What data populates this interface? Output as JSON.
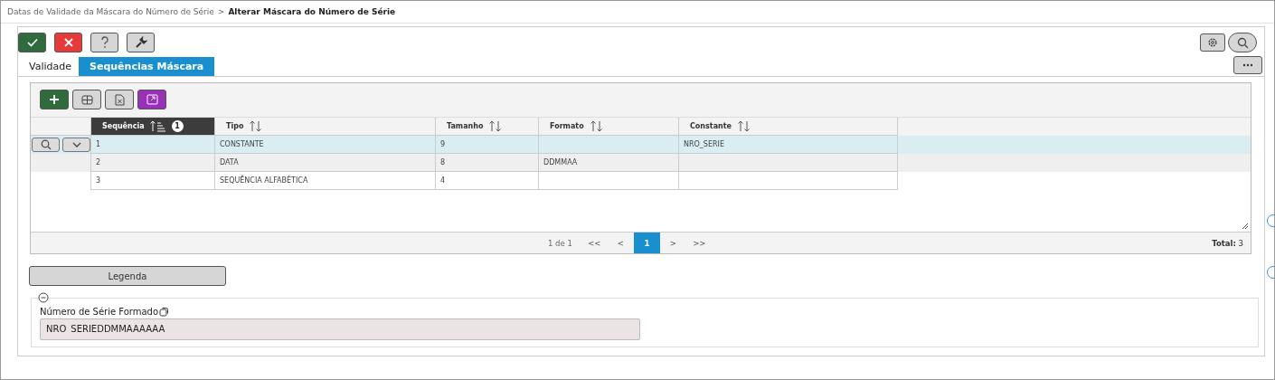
{
  "breadcrumb": {
    "parent": "Datas de Validade da Máscara do Número de Série",
    "separator": ">",
    "current": "Alterar Máscara do Número de Série"
  },
  "toolbar": [
    {
      "kind": "confirm"
    },
    {
      "kind": "cancel"
    },
    {
      "kind": "help"
    },
    {
      "kind": "tools"
    }
  ],
  "tabs": [
    {
      "label": "Validade",
      "selected": false
    },
    {
      "label": "Sequências Máscara",
      "selected": true
    }
  ],
  "grid": {
    "toolbar": [
      {
        "kind": "add"
      },
      {
        "kind": "columns"
      },
      {
        "kind": "export"
      },
      {
        "kind": "expand"
      }
    ],
    "columns": [
      {
        "label": "Sequência",
        "sorted": true,
        "sort_rank": "1"
      },
      {
        "label": "Tipo",
        "sorted": false
      },
      {
        "label": "Tamanho",
        "sorted": false
      },
      {
        "label": "Formato",
        "sorted": false
      },
      {
        "label": "Constante",
        "sorted": false
      }
    ],
    "rows": [
      {
        "selected": true,
        "cells": [
          "1",
          "CONSTANTE",
          "9",
          "",
          "NRO_SERIE"
        ]
      },
      {
        "selected": false,
        "cells": [
          "2",
          "DATA",
          "8",
          "DDMMAA",
          ""
        ]
      },
      {
        "selected": false,
        "cells": [
          "3",
          "SEQUÊNCIA ALFABÉTICA",
          "4",
          "",
          ""
        ]
      }
    ],
    "pager": {
      "info": "1 de 1",
      "first": "<<",
      "prev": "<",
      "pages": [
        {
          "label": "1",
          "selected": true
        }
      ],
      "next": ">",
      "last": ">>",
      "total_label": "Total:",
      "total": "3"
    }
  },
  "legend_button": "Legenda",
  "formed": {
    "label": "Número de Série Formado",
    "value": "NRO_SERIEDDMMAAAAAA"
  }
}
